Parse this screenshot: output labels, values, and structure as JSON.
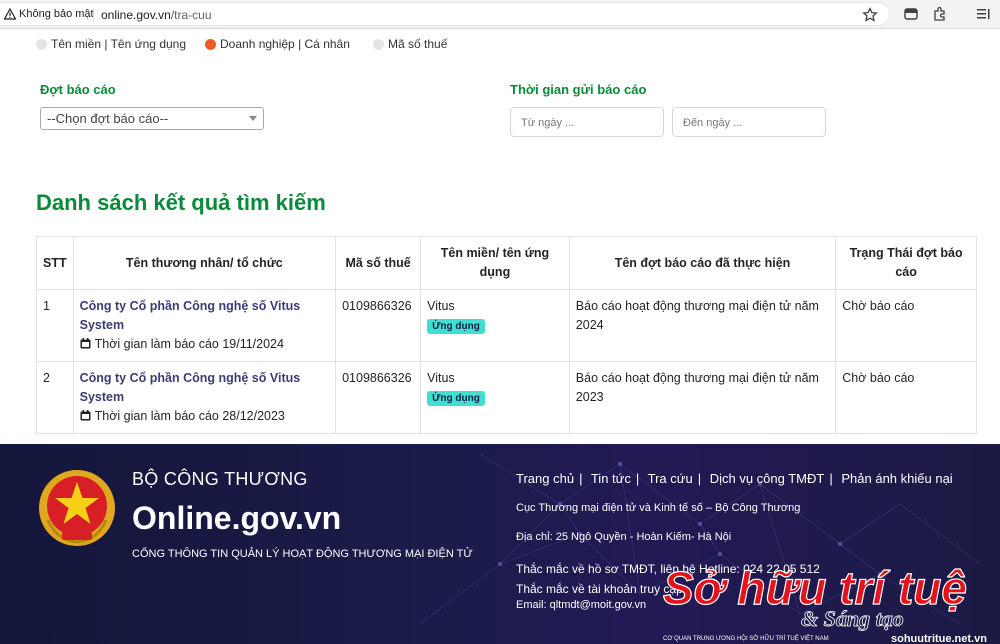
{
  "browser": {
    "security_label": "Không bảo mật",
    "url_host": "online.gov.vn",
    "url_path": "/tra-cuu"
  },
  "search": {
    "options": [
      {
        "label": "Tên miền | Tên ứng dụng",
        "selected": false
      },
      {
        "label": "Doanh nghiệp | Cá nhân",
        "selected": true
      },
      {
        "label": "Mã số thuế",
        "selected": false
      }
    ],
    "period_label": "Đợt báo cáo",
    "period_select": "--Chọn đợt báo cáo--",
    "time_label": "Thời gian gửi báo cáo",
    "from_placeholder": "Từ ngày ...",
    "to_placeholder": "Đến ngày ..."
  },
  "results": {
    "title": "Danh sách kết quả tìm kiếm",
    "headers": [
      "STT",
      "Tên thương nhân/ tổ chức",
      "Mã số thuế",
      "Tên miền/ tên ứng dụng",
      "Tên đợt báo cáo đã thực hiện",
      "Trạng Thái đợt báo cáo"
    ],
    "rows": [
      {
        "stt": "1",
        "company": "Công ty Cổ phần Công nghệ số Vitus System",
        "time_text": "Thời gian làm báo cáo 19/11/2024",
        "tax": "0109866326",
        "app": "Vitus",
        "badge": "Ứng dụng",
        "report": "Báo cáo hoạt động thương mại điện tử năm 2024",
        "status": "Chờ báo cáo"
      },
      {
        "stt": "2",
        "company": "Công ty Cổ phần Công nghệ số Vitus System",
        "time_text": "Thời gian làm báo cáo 28/12/2023",
        "tax": "0109866326",
        "app": "Vitus",
        "badge": "Ứng dụng",
        "report": "Báo cáo hoạt động thương mại điện tử năm 2023",
        "status": "Chờ báo cáo"
      }
    ]
  },
  "footer": {
    "ministry": "BỘ CÔNG THƯƠNG",
    "site": "Online.gov.vn",
    "description": "CỔNG THÔNG TIN QUẢN LÝ HOẠT ĐỘNG THƯƠNG MẠI ĐIỆN TỬ",
    "links": [
      "Trang chủ",
      "Tin tức",
      "Tra cứu",
      "Dịch vụ công TMĐT",
      "Phản ánh khiếu nại"
    ],
    "agency": "Cục Thương mại điện tử và Kinh tế số – Bộ Công Thương",
    "address": "Địa chỉ: 25 Ngô Quyền - Hoàn Kiếm- Hà Nội",
    "hotline": "Thắc mắc về hồ sơ TMĐT, liên hệ Hotline: 024 22 05 512",
    "account": "Thắc mắc về tài khoản truy cập",
    "email": "Email: qltmdt@moit.gov.vn"
  },
  "watermark": {
    "main": "Sở hữu trí tuệ",
    "sub": "& Sáng tạo",
    "tagline": "CƠ QUAN TRUNG ƯƠNG HỘI SỞ HỮU TRÍ TUỆ VIỆT NAM",
    "site": "sohuutritue.net.vn"
  },
  "colors": {
    "accent_green": "#0a8a3a",
    "radio_selected": "#f05a22",
    "badge": "#3fe0d0",
    "watermark_red": "#e3131b"
  }
}
